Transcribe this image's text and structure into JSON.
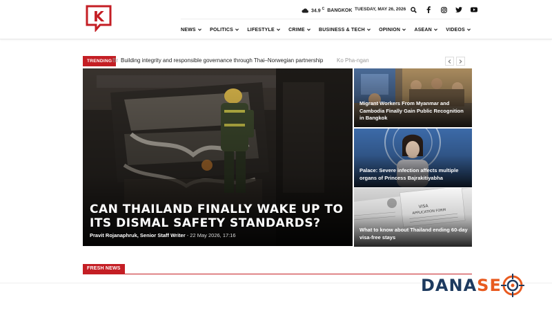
{
  "header": {
    "logo_letter": "K",
    "weather": {
      "temp": "34.9",
      "unit": "C",
      "city": "BANGKOK"
    },
    "date": "TUESDAY, MAY 26, 2026",
    "nav": [
      "NEWS",
      "POLITICS",
      "LIFESTYLE",
      "CRIME",
      "BUSINESS & TECH",
      "OPINION",
      "ASEAN",
      "VIDEOS"
    ]
  },
  "trending": {
    "label": "TRENDING",
    "ghost_text": "Br",
    "headline": "Building integrity and responsible governance through Thai–Norwegian partnership",
    "tail_text": "Ko Pha-ngan"
  },
  "hero": {
    "title_line1": "CAN THAILAND FINALLY WAKE UP TO",
    "title_line2": "ITS DISMAL SAFETY STANDARDS?",
    "author": "Pravit Rojanaphruk, Senior Staff Writer",
    "date": " - 22 May 2026, 17:16"
  },
  "cards": [
    {
      "title": "Migrant Workers From Myanmar and Cambodia Finally Gain Public Recognition in Bangkok"
    },
    {
      "title": "Palace: Severe infection affects multiple organs of Princess Bajrakitiyabha"
    },
    {
      "title": "What to know about Thailand ending 60-day visa-free stays"
    }
  ],
  "fresh_news": {
    "label": "FRESH NEWS"
  },
  "watermark": {
    "part1": "DANA",
    "part2": "SE"
  },
  "colors": {
    "accent": "#c41e24",
    "watermark_blue": "#1d3a5f",
    "watermark_orange": "#e85a1f"
  }
}
